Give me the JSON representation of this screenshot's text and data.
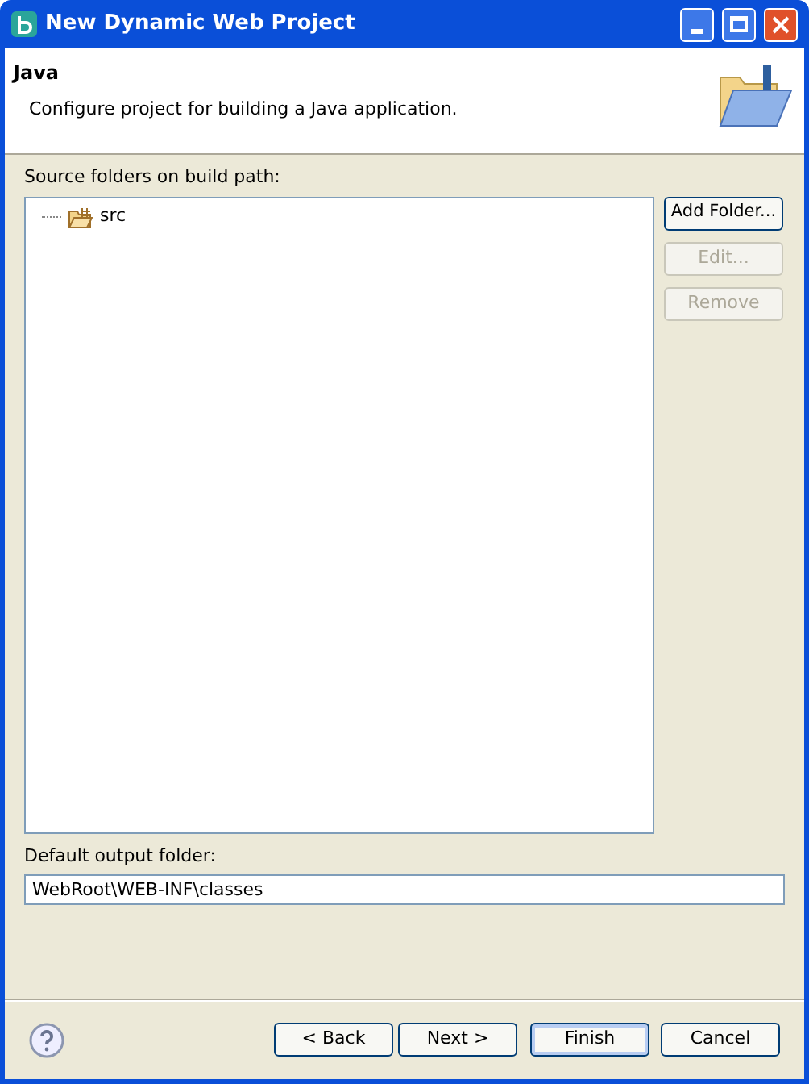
{
  "window": {
    "title": "New Dynamic Web Project"
  },
  "header": {
    "title": "Java",
    "description": "Configure project for building a Java application."
  },
  "source_folders": {
    "label": "Source folders on build path:",
    "items": [
      {
        "label": "src"
      }
    ]
  },
  "side_buttons": [
    {
      "label": "Add Folder...",
      "disabled": false
    },
    {
      "label": "Edit...",
      "disabled": true
    },
    {
      "label": "Remove",
      "disabled": true
    }
  ],
  "output_folder": {
    "label": "Default output folder:",
    "value": "WebRoot\\WEB-INF\\classes"
  },
  "footer_buttons": [
    {
      "label": "< Back",
      "default": false
    },
    {
      "label": "Next >",
      "default": false
    },
    {
      "label": "Finish",
      "default": true
    },
    {
      "label": "Cancel",
      "default": false
    }
  ]
}
